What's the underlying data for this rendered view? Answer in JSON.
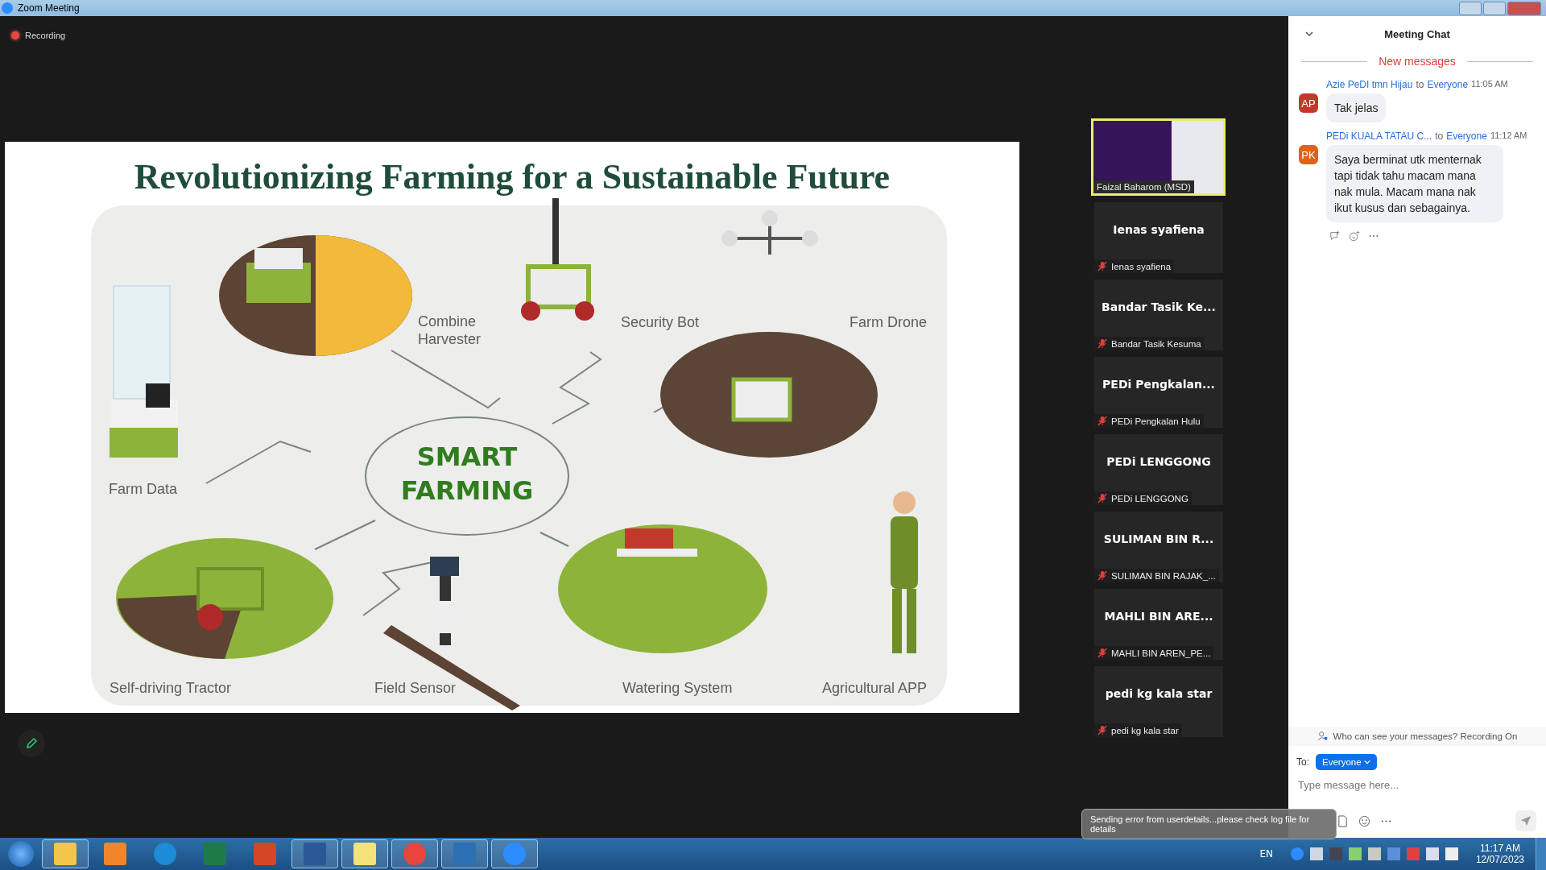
{
  "window": {
    "title": "Zoom Meeting"
  },
  "recording": {
    "label": "Recording"
  },
  "slide": {
    "title": "Revolutionizing Farming for a Sustainable Future",
    "center_label": "SMART FARMING",
    "labels": [
      {
        "text": "Combine Harvester"
      },
      {
        "text": "Security Bot"
      },
      {
        "text": "Farm Drone"
      },
      {
        "text": "Farm Data"
      },
      {
        "text": "Self-driving Tractor"
      },
      {
        "text": "Field Sensor"
      },
      {
        "text": "Watering System"
      },
      {
        "text": "Agricultural APP"
      }
    ]
  },
  "participants": [
    {
      "kind": "video",
      "caption": "Faizal Baharom (MSD)",
      "speaking": true,
      "muted": false
    },
    {
      "kind": "name",
      "heading": "Ienas syafiena",
      "caption": "Ienas syafiena",
      "speaking": false,
      "muted": true
    },
    {
      "kind": "name",
      "heading": "Bandar Tasik Ke...",
      "caption": "Bandar Tasik Kesuma",
      "speaking": false,
      "muted": true
    },
    {
      "kind": "name",
      "heading": "PEDi  Pengkalan...",
      "caption": "PEDi Pengkalan Hulu",
      "speaking": false,
      "muted": true
    },
    {
      "kind": "name",
      "heading": "PEDi LENGGONG",
      "caption": "PEDi LENGGONG",
      "speaking": false,
      "muted": true
    },
    {
      "kind": "name",
      "heading": "SULIMAN BIN R...",
      "caption": "SULIMAN BIN RAJAK_...",
      "speaking": false,
      "muted": true
    },
    {
      "kind": "name",
      "heading": "MAHLI BIN ARE...",
      "caption": "MAHLI BIN AREN_PE...",
      "speaking": false,
      "muted": true
    },
    {
      "kind": "name",
      "heading": "pedi kg kala star",
      "caption": "pedi kg kala star",
      "speaking": false,
      "muted": true
    }
  ],
  "chat": {
    "title": "Meeting Chat",
    "divider": "New messages",
    "messages": [
      {
        "sender": "Azie PeDI tmn Hijau",
        "to": "to",
        "recipient": "Everyone",
        "time": "11:05 AM",
        "initials": "AP",
        "color": "#c0392b",
        "text": "Tak jelas"
      },
      {
        "sender": "PEDi KUALA TATAU C...",
        "to": "to",
        "recipient": "Everyone",
        "time": "11:12 AM",
        "initials": "PK",
        "color": "#e0621a",
        "text": "Saya berminat utk menternak tapi tidak tahu macam mana nak mula. Macam mana nak ikut kusus dan sebagainya."
      }
    ],
    "privacy_note": "Who can see your messages? Recording On",
    "to_label": "To:",
    "recipient": "Everyone",
    "placeholder": "Type message here..."
  },
  "toast": {
    "text": "Sending error from userdetails...please check log file for details"
  },
  "taskbar": {
    "apps": [
      {
        "kind": "folder",
        "running": true
      },
      {
        "kind": "player",
        "running": false
      },
      {
        "kind": "edge",
        "running": false
      },
      {
        "kind": "excel",
        "running": false
      },
      {
        "kind": "powerpoint",
        "running": false
      },
      {
        "kind": "word",
        "running": true
      },
      {
        "kind": "notes",
        "running": true
      },
      {
        "kind": "chrome",
        "running": true
      },
      {
        "kind": "monitor",
        "running": true
      },
      {
        "kind": "zoom",
        "running": true
      }
    ],
    "language": "EN",
    "time": "11:17 AM",
    "date": "12/07/2023"
  }
}
